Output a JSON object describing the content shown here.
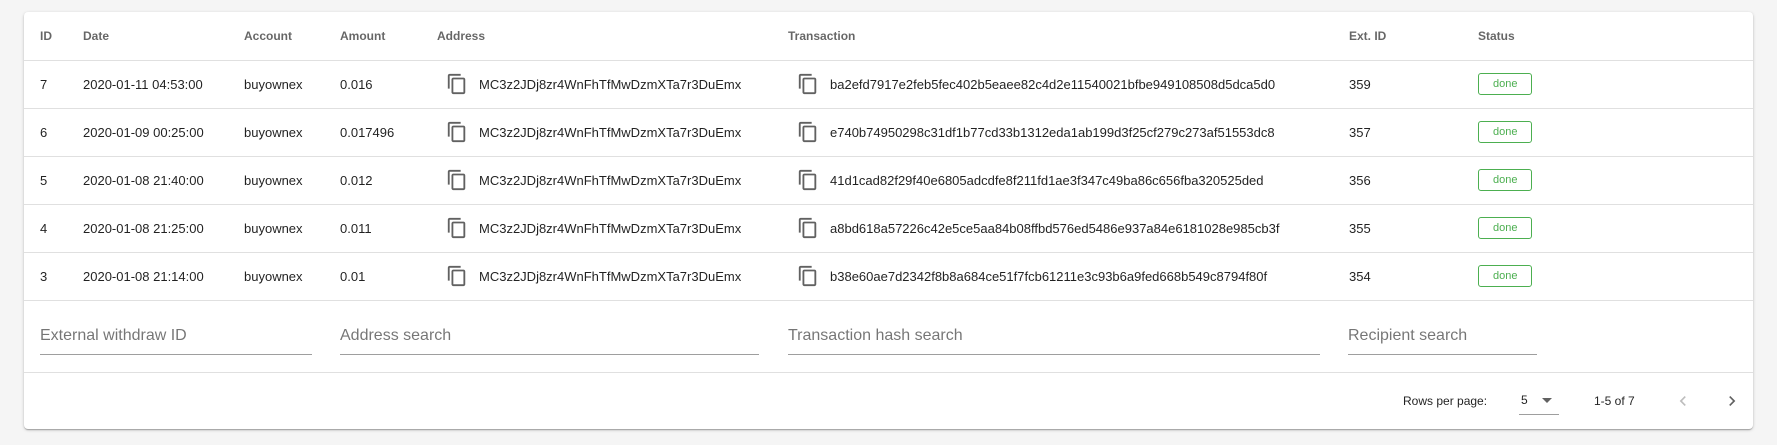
{
  "columns": {
    "id": "ID",
    "date": "Date",
    "account": "Account",
    "amount": "Amount",
    "address": "Address",
    "transaction": "Transaction",
    "ext_id": "Ext. ID",
    "status": "Status"
  },
  "rows": [
    {
      "id": "7",
      "date": "2020-01-11 04:53:00",
      "account": "buyownex",
      "amount": "0.016",
      "address": "MC3z2JDj8zr4WnFhTfMwDzmXTa7r3DuEmx",
      "transaction": "ba2efd7917e2feb5fec402b5eaee82c4d2e11540021bfbe949108508d5dca5d0",
      "ext_id": "359",
      "status": "done"
    },
    {
      "id": "6",
      "date": "2020-01-09 00:25:00",
      "account": "buyownex",
      "amount": "0.017496",
      "address": "MC3z2JDj8zr4WnFhTfMwDzmXTa7r3DuEmx",
      "transaction": "e740b74950298c31df1b77cd33b1312eda1ab199d3f25cf279c273af51553dc8",
      "ext_id": "357",
      "status": "done"
    },
    {
      "id": "5",
      "date": "2020-01-08 21:40:00",
      "account": "buyownex",
      "amount": "0.012",
      "address": "MC3z2JDj8zr4WnFhTfMwDzmXTa7r3DuEmx",
      "transaction": "41d1cad82f29f40e6805adcdfe8f211fd1ae3f347c49ba86c656fba320525ded",
      "ext_id": "356",
      "status": "done"
    },
    {
      "id": "4",
      "date": "2020-01-08 21:25:00",
      "account": "buyownex",
      "amount": "0.011",
      "address": "MC3z2JDj8zr4WnFhTfMwDzmXTa7r3DuEmx",
      "transaction": "a8bd618a57226c42e5ce5aa84b08ffbd576ed5486e937a84e6181028e985cb3f",
      "ext_id": "355",
      "status": "done"
    },
    {
      "id": "3",
      "date": "2020-01-08 21:14:00",
      "account": "buyownex",
      "amount": "0.01",
      "address": "MC3z2JDj8zr4WnFhTfMwDzmXTa7r3DuEmx",
      "transaction": "b38e60ae7d2342f8b8a684ce51f7fcb61211e3c93b6a9fed668b549c8794f80f",
      "ext_id": "354",
      "status": "done"
    }
  ],
  "filters": {
    "external_withdraw_id": {
      "placeholder": "External withdraw ID",
      "value": ""
    },
    "address": {
      "placeholder": "Address search",
      "value": ""
    },
    "transaction": {
      "placeholder": "Transaction hash search",
      "value": ""
    },
    "recipient": {
      "placeholder": "Recipient search",
      "value": ""
    }
  },
  "pagination": {
    "rows_per_page_label": "Rows per page:",
    "rows_per_page": "5",
    "range": "1-5 of 7"
  },
  "icons": {
    "copy": "copy-icon",
    "prev": "chevron-left-icon",
    "next": "chevron-right-icon",
    "dropdown": "caret-down-icon"
  },
  "colors": {
    "status_done": "#4caf50",
    "divider": "#e0e0e0",
    "icon": "#616161"
  }
}
